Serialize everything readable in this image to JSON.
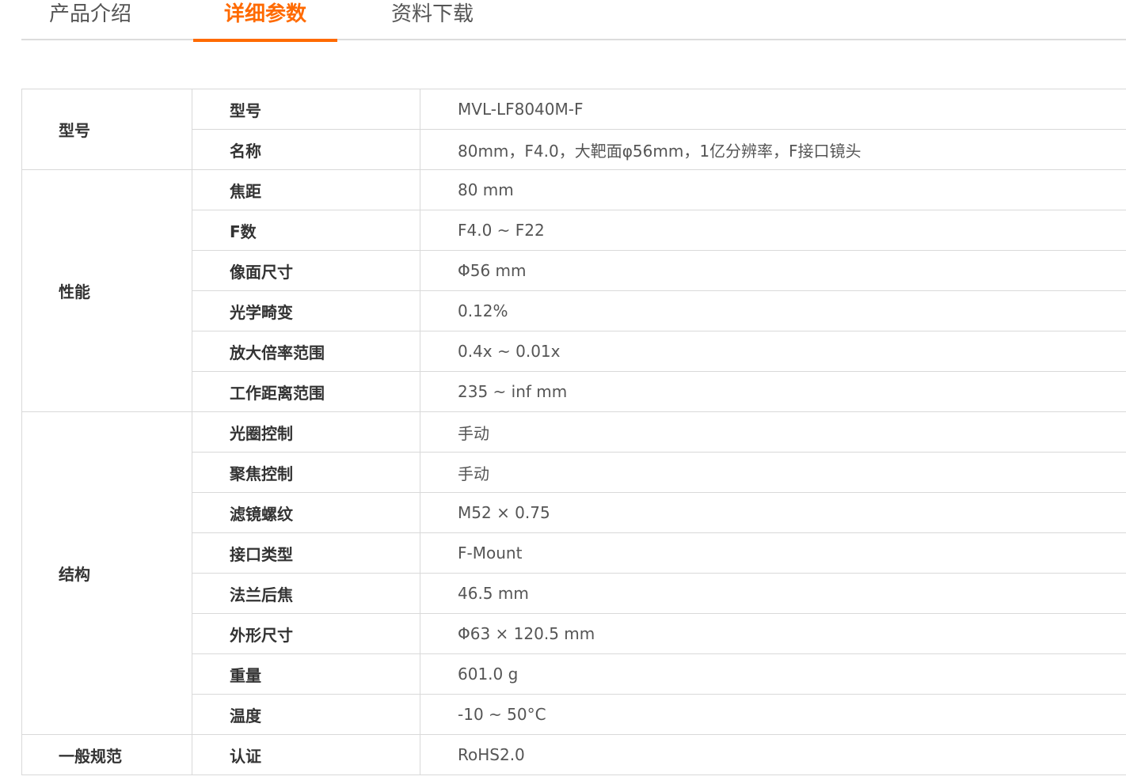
{
  "tabs": [
    {
      "label": "产品介绍",
      "active": false
    },
    {
      "label": "详细参数",
      "active": true
    },
    {
      "label": "资料下载",
      "active": false
    }
  ],
  "accent_color": "#ff6a00",
  "groups": [
    {
      "name": "型号",
      "rows": [
        {
          "key": "型号",
          "value": "MVL-LF8040M-F"
        },
        {
          "key": "名称",
          "value": "80mm，F4.0，大靶面φ56mm，1亿分辨率，F接口镜头"
        }
      ]
    },
    {
      "name": "性能",
      "rows": [
        {
          "key": "焦距",
          "value": "80 mm"
        },
        {
          "key": "F数",
          "value": "F4.0 ~ F22"
        },
        {
          "key": "像面尺寸",
          "value": "Φ56 mm"
        },
        {
          "key": "光学畸变",
          "value": "0.12%"
        },
        {
          "key": "放大倍率范围",
          "value": "0.4x ~ 0.01x"
        },
        {
          "key": "工作距离范围",
          "value": "235 ~ inf mm"
        }
      ]
    },
    {
      "name": "结构",
      "rows": [
        {
          "key": "光圈控制",
          "value": "手动"
        },
        {
          "key": "聚焦控制",
          "value": "手动"
        },
        {
          "key": "滤镜螺纹",
          "value": "M52 × 0.75"
        },
        {
          "key": "接口类型",
          "value": "F-Mount"
        },
        {
          "key": "法兰后焦",
          "value": "46.5 mm"
        },
        {
          "key": "外形尺寸",
          "value": "Φ63 × 120.5 mm"
        },
        {
          "key": "重量",
          "value": "601.0 g"
        },
        {
          "key": "温度",
          "value": "-10 ~ 50°C"
        }
      ]
    },
    {
      "name": "一般规范",
      "rows": [
        {
          "key": "认证",
          "value": "RoHS2.0"
        }
      ]
    }
  ]
}
